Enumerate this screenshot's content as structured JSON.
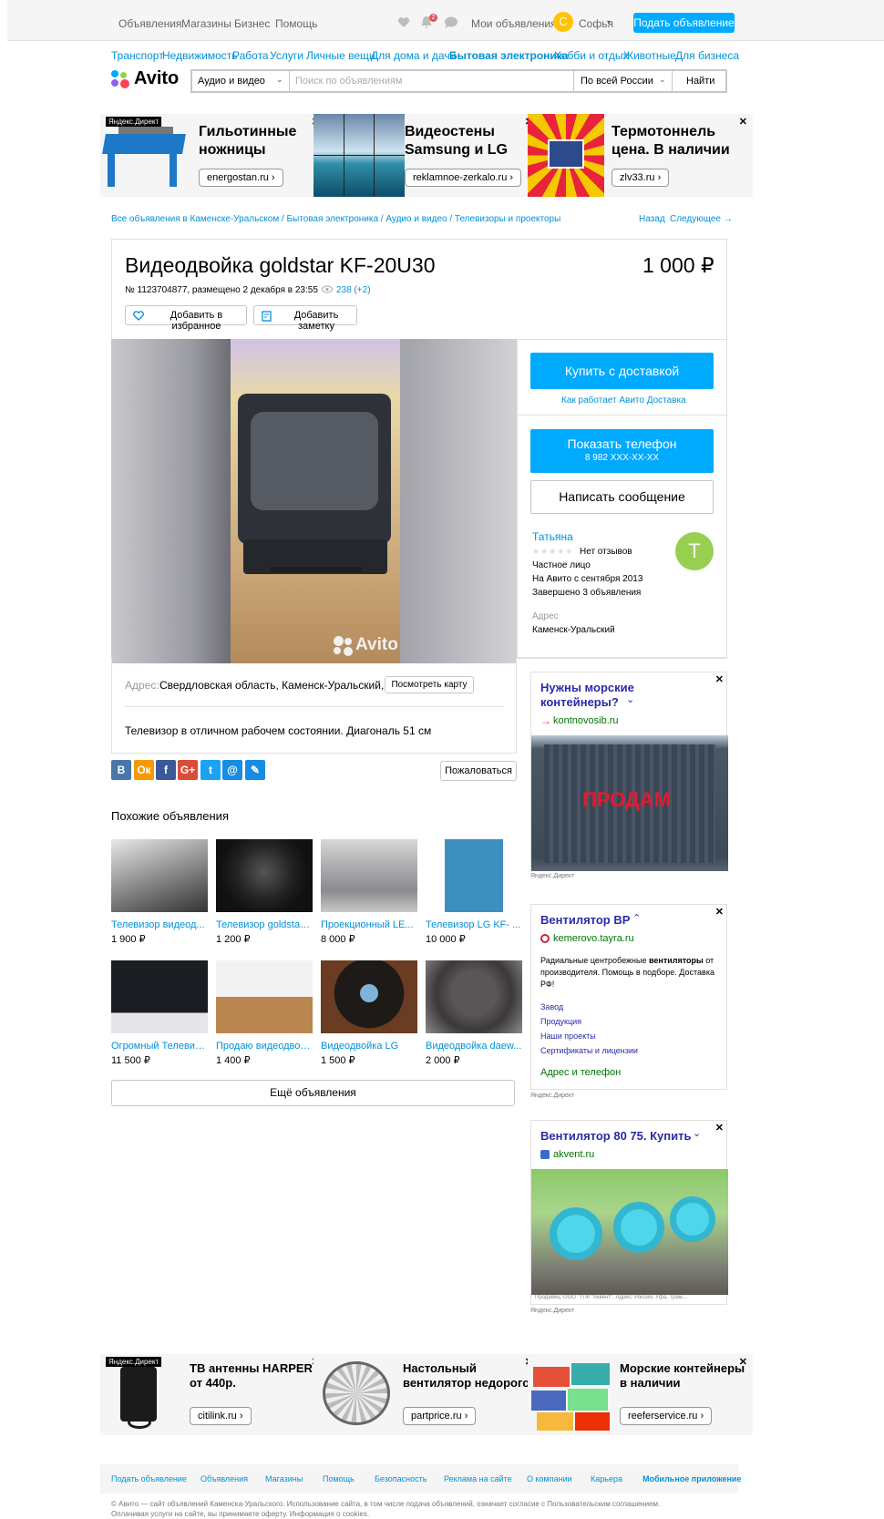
{
  "topbar": {
    "nav": [
      "Объявления",
      "Магазины",
      "Бизнес",
      "Помощь"
    ],
    "notif_count": "2",
    "my_ads": "Мои объявления",
    "avatar_letter": "С",
    "user": "Софья",
    "post": "Подать объявление"
  },
  "cats": [
    "Транспорт",
    "Недвижимость",
    "Работа",
    "Услуги",
    "Личные вещи",
    "Для дома и дачи",
    "Бытовая электроника",
    "Хобби и отдых",
    "Животные",
    "Для бизнеса"
  ],
  "search": {
    "logo": "Avito",
    "category": "Аудио и видео",
    "placeholder": "Поиск по объявлениям",
    "region": "По всей России",
    "submit": "Найти"
  },
  "ads_top": [
    {
      "label": "Яндекс.Директ",
      "title": "Гильотинные ножницы",
      "domain": "energostan.ru ›"
    },
    {
      "title": "Видеостены Samsung и LG",
      "domain": "reklamnoe-zerkalo.ru ›"
    },
    {
      "title": "Термотоннель цена. В наличии",
      "domain": "zlv33.ru ›"
    }
  ],
  "breadcrumbs": {
    "path": "Все объявления в Каменске-Уральском / Бытовая электроника / Аудио и видео / Телевизоры и проекторы",
    "back": "Назад",
    "next": "Следующее →"
  },
  "item": {
    "title": "Видеодвойка goldstar KF-20U30",
    "price": "1 000 ₽",
    "meta": "№ 1123704877, размещено 2 декабря в 23:55",
    "views": "238 (+2)",
    "fav": "Добавить в избранное",
    "note": "Добавить заметку",
    "watermark": "Avito",
    "address_label": "Адрес:",
    "address": "Свердловская область, Каменск-Уральский,",
    "map_btn": "Посмотреть карту",
    "description": "Телевизор в отличном рабочем состоянии. Диагональ 51 см",
    "complain": "Пожаловаться"
  },
  "share": [
    "В",
    "Ок",
    "f",
    "G+",
    "t",
    "@",
    "✎"
  ],
  "seller": {
    "buy": "Купить с доставкой",
    "how": "Как работает Авито Доставка",
    "phone_btn": "Показать телефон",
    "phone": "8 982 XXX-XX-XX",
    "message": "Написать сообщение",
    "name": "Татьяна",
    "reviews": "Нет отзывов",
    "type": "Частное лицо",
    "since": "На Авито с сентября 2013",
    "done": "Завершено 3 объявления",
    "addr_label": "Адрес",
    "addr": "Каменск-Уральский",
    "avatar": "Т"
  },
  "similar": {
    "heading": "Похожие объявления",
    "more": "Ещё объявления",
    "items": [
      {
        "title": "Телевизор видеод...",
        "price": "1 900 ₽"
      },
      {
        "title": "Телевизор goldstar ...",
        "price": "1 200 ₽"
      },
      {
        "title": "Проекционный LE...",
        "price": "8 000 ₽"
      },
      {
        "title": "Телевизор LG KF- ...",
        "price": "10 000 ₽"
      },
      {
        "title": "Огромный Телевиз...",
        "price": "11 500 ₽"
      },
      {
        "title": "Продаю видеодвой...",
        "price": "1 400 ₽"
      },
      {
        "title": "Видеодвойка LG",
        "price": "1 500 ₽"
      },
      {
        "title": "Видеодвойка daew...",
        "price": "2 000 ₽"
      }
    ]
  },
  "side_ads": [
    {
      "title": "Нужны морские контейнеры?",
      "domain": "kontnovosib.ru",
      "img_text": "ПРОДАМ",
      "label": "Яндекс.Директ"
    },
    {
      "title": "Вентилятор ВР",
      "domain": "kemerovo.tayra.ru",
      "text_a": "Радиальные центробежные ",
      "text_b": "вентиляторы",
      "text_c": " от производителя. Помощь в подборе. Доставка РФ!",
      "links": [
        "Завод",
        "Продукция",
        "Наши проекты",
        "Сертификаты и лицензии"
      ],
      "contact": "Адрес и телефон",
      "label": "Яндекс.Директ"
    },
    {
      "title": "Вентилятор 80 75. Купить",
      "domain": "akvent.ru",
      "seller": "Продавец: ООО \"ТПК \"Аквент\", Адрес: Россия, Уфа, Трам...",
      "label": "Яндекс.Директ"
    }
  ],
  "ads_bottom": [
    {
      "label": "Яндекс.Директ",
      "title": "ТВ антенны HARPER от 440р.",
      "domain": "citilink.ru ›"
    },
    {
      "title": "Настольный вентилятор недорого",
      "domain": "partprice.ru ›"
    },
    {
      "title": "Морские контейнеры в наличии",
      "domain": "reeferservice.ru ›"
    }
  ],
  "footer": {
    "links": [
      "Подать объявление",
      "Объявления",
      "Магазины",
      "Помощь",
      "Безопасность",
      "Реклама на сайте",
      "О компании",
      "Карьера",
      "Мобильное приложение"
    ],
    "legal1": "© Авито — сайт объявлений Каменска-Уральского. Использование сайта, в том числе подача объявлений, означает согласие с Пользовательским соглашением.",
    "legal2": "Оплачивая услуги на сайте, вы принимаете оферту. Информация о cookies."
  },
  "colors": {
    "brand_blue": "#00aaff",
    "link": "#0091d9",
    "avatar_green": "#97cf50",
    "avatar_yellow": "#ffc400"
  }
}
